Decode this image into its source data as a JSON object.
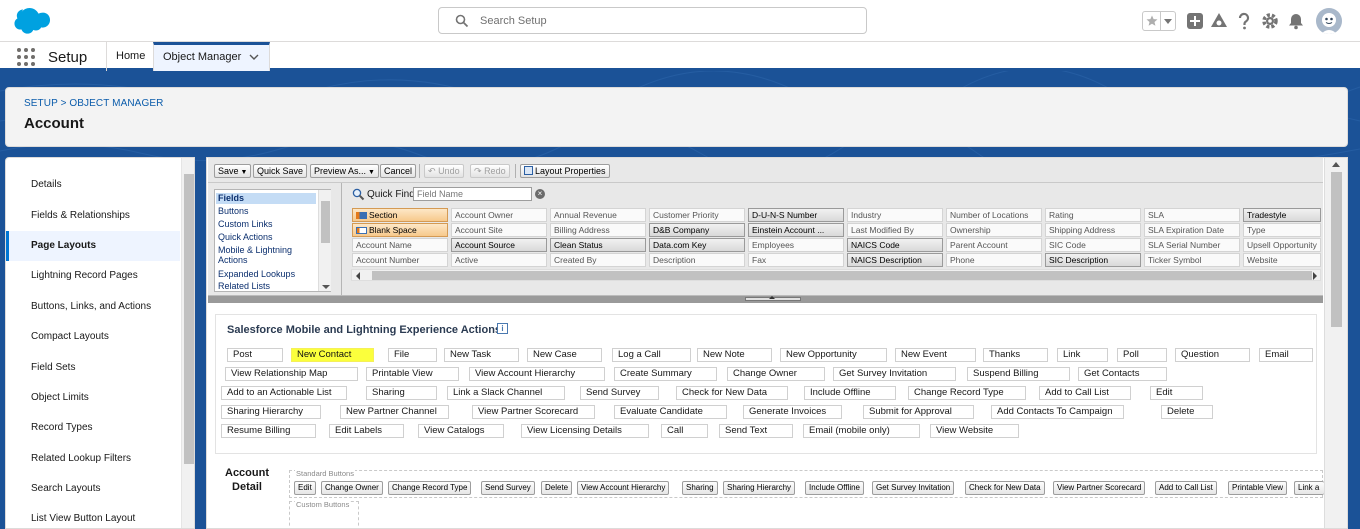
{
  "header": {
    "search_placeholder": "Search Setup",
    "icons": [
      "salesforce-cloud-logo",
      "search-icon",
      "star-icon",
      "chevron-down-icon",
      "plus-icon",
      "trailhead-icon",
      "help-icon",
      "gear-icon",
      "bell-icon",
      "avatar"
    ],
    "brand_color": "#1b96ff"
  },
  "context_bar": {
    "app_name": "Setup",
    "tabs": [
      {
        "label": "Home"
      },
      {
        "label": "Object Manager",
        "active": true
      }
    ]
  },
  "page_header": {
    "breadcrumb": [
      "SETUP",
      "OBJECT MANAGER"
    ],
    "breadcrumb_sep": ">",
    "title": "Account"
  },
  "sidebar": {
    "items": [
      {
        "label": "Details"
      },
      {
        "label": "Fields & Relationships"
      },
      {
        "label": "Page Layouts",
        "active": true
      },
      {
        "label": "Lightning Record Pages"
      },
      {
        "label": "Buttons, Links, and Actions"
      },
      {
        "label": "Compact Layouts"
      },
      {
        "label": "Field Sets"
      },
      {
        "label": "Object Limits"
      },
      {
        "label": "Record Types"
      },
      {
        "label": "Related Lookup Filters"
      },
      {
        "label": "Search Layouts"
      },
      {
        "label": "List View Button Layout"
      }
    ]
  },
  "toolbar": {
    "save": "Save",
    "quick_save": "Quick Save",
    "preview_as": "Preview As...",
    "cancel": "Cancel",
    "undo": "Undo",
    "redo": "Redo",
    "layout_properties": "Layout Properties"
  },
  "palette": {
    "categories": [
      "Fields",
      "Buttons",
      "Custom Links",
      "Quick Actions",
      "Mobile & Lightning Actions",
      "Expanded Lookups",
      "Related Lists"
    ],
    "selected_category": "Fields",
    "quick_find_label": "Quick Find",
    "quick_find_placeholder": "Field Name",
    "rows": [
      [
        "Section",
        "Account Owner",
        "Annual Revenue",
        "Customer Priority",
        "D-U-N-S Number",
        "Industry",
        "Number of Locations",
        "Rating",
        "SLA",
        "Tradestyle"
      ],
      [
        "Blank Space",
        "Account Site",
        "Billing Address",
        "D&B Company",
        "Einstein Account ...",
        "Last Modified By",
        "Ownership",
        "Shipping Address",
        "SLA Expiration Date",
        "Type"
      ],
      [
        "Account Name",
        "Account Source",
        "Clean Status",
        "Data.com Key",
        "Employees",
        "NAICS Code",
        "Parent Account",
        "SIC Code",
        "SLA Serial Number",
        "Upsell Opportunity"
      ],
      [
        "Account Number",
        "Active",
        "Created By",
        "Description",
        "Fax",
        "NAICS Description",
        "Phone",
        "SIC Description",
        "Ticker Symbol",
        "Website"
      ]
    ]
  },
  "actions_section": {
    "title": "Salesforce Mobile and Lightning Experience Actions",
    "highlight_color": "#fbff3c",
    "rows": [
      [
        "Post",
        "New Contact",
        "File",
        "New Task",
        "New Case",
        "Log a Call",
        "New Note",
        "New Opportunity",
        "New Event",
        "Thanks",
        "Link",
        "Poll",
        "Question",
        "Email"
      ],
      [
        "View Relationship Map",
        "Printable View",
        "View Account Hierarchy",
        "Create Summary",
        "Change Owner",
        "Get Survey Invitation",
        "Suspend Billing",
        "Get Contacts"
      ],
      [
        "Add to an Actionable List",
        "Sharing",
        "Link a Slack Channel",
        "Send Survey",
        "Check for New Data",
        "Include Offline",
        "Change Record Type",
        "Add to Call List",
        "Edit"
      ],
      [
        "Sharing Hierarchy",
        "New Partner Channel",
        "View Partner Scorecard",
        "Evaluate Candidate",
        "Generate Invoices",
        "Submit for Approval",
        "Add Contacts To Campaign",
        "Delete"
      ],
      [
        "Resume Billing",
        "Edit Labels",
        "View Catalogs",
        "View Licensing Details",
        "Call",
        "Send Text",
        "Email (mobile only)",
        "View Website"
      ]
    ],
    "highlighted": "New Contact"
  },
  "account_detail": {
    "title_line1": "Account",
    "title_line2": "Detail",
    "standard_buttons_label": "Standard Buttons",
    "custom_buttons_label": "Custom Buttons",
    "buttons": [
      "Edit",
      "Change Owner",
      "Change Record Type",
      "Send Survey",
      "Delete",
      "View Account Hierarchy",
      "Sharing",
      "Sharing Hierarchy",
      "Include Offline",
      "Get Survey Invitation",
      "Check for New Data",
      "View Partner Scorecard",
      "Add to Call List",
      "Printable View",
      "Link a"
    ]
  }
}
